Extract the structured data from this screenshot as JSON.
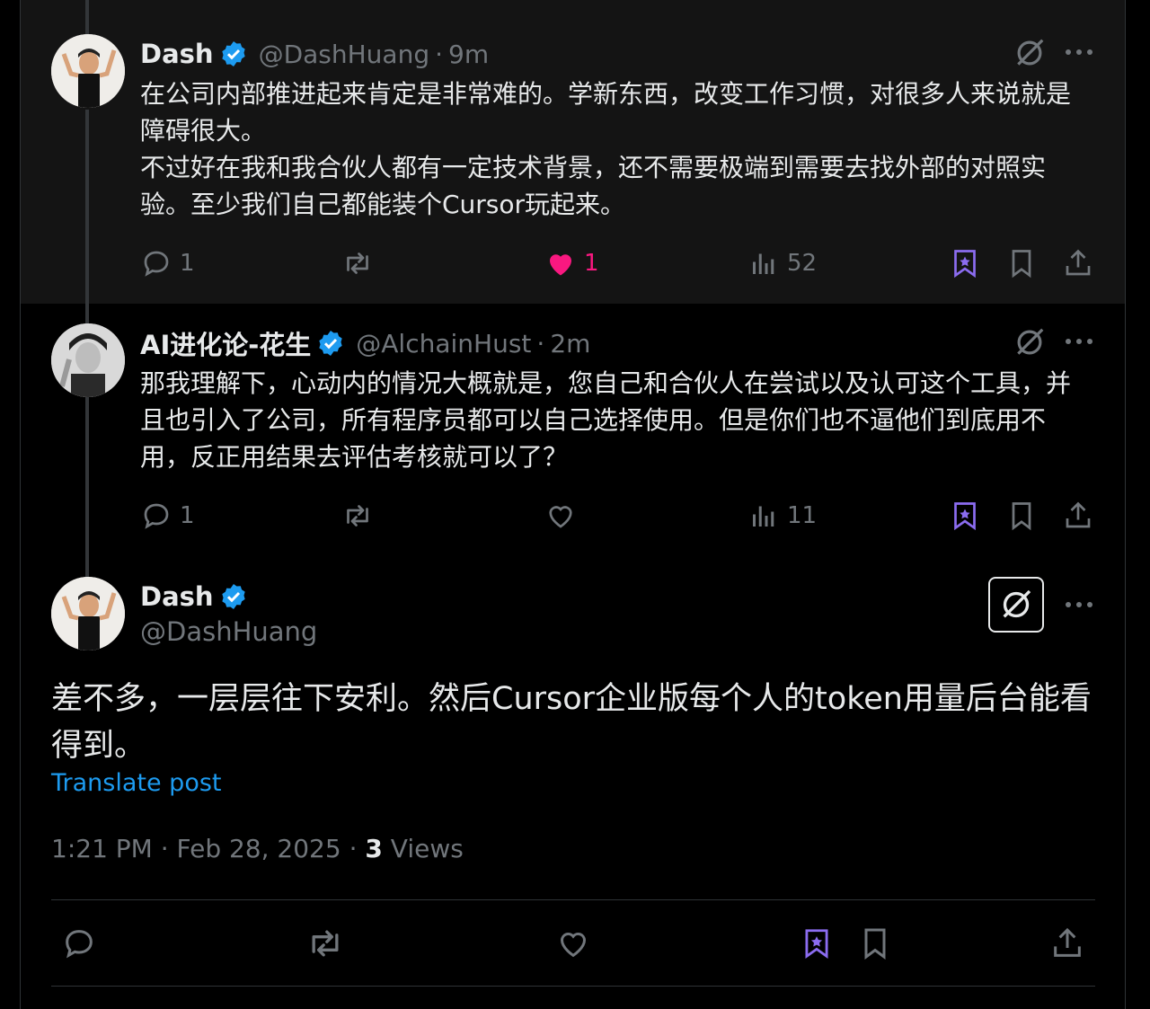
{
  "colors": {
    "accent": "#1d9bf0",
    "like": "#f91880",
    "grok": "#8b6cf0",
    "muted": "#71767b"
  },
  "posts": [
    {
      "name": "Dash",
      "handle": "@DashHuang",
      "separator": "·",
      "time": "9m",
      "text": "在公司内部推进起来肯定是非常难的。学新东西，改变工作习惯，对很多人来说就是障碍很大。\n不过好在我和我合伙人都有一定技术背景，还不需要极端到需要去找外部的对照实验。至少我们自己都能装个Cursor玩起来。",
      "replies": "1",
      "likes": "1",
      "views": "52"
    },
    {
      "name": "AI进化论-花生",
      "handle": "@AlchainHust",
      "separator": "·",
      "time": "2m",
      "text": "那我理解下，心动内的情况大概就是，您自己和合伙人在尝试以及认可这个工具，并且也引入了公司，所有程序员都可以自己选择使用。但是你们也不逼他们到底用不用，反正用结果去评估考核就可以了？",
      "replies": "1",
      "likes": "",
      "views": "11"
    }
  ],
  "main": {
    "name": "Dash",
    "handle": "@DashHuang",
    "text": "差不多，一层层往下安利。然后Cursor企业版每个人的token用量后台能看得到。",
    "translate": "Translate post",
    "timestamp": "1:21 PM · Feb 28, 2025 · ",
    "views_count": "3",
    "views_label": " Views"
  }
}
